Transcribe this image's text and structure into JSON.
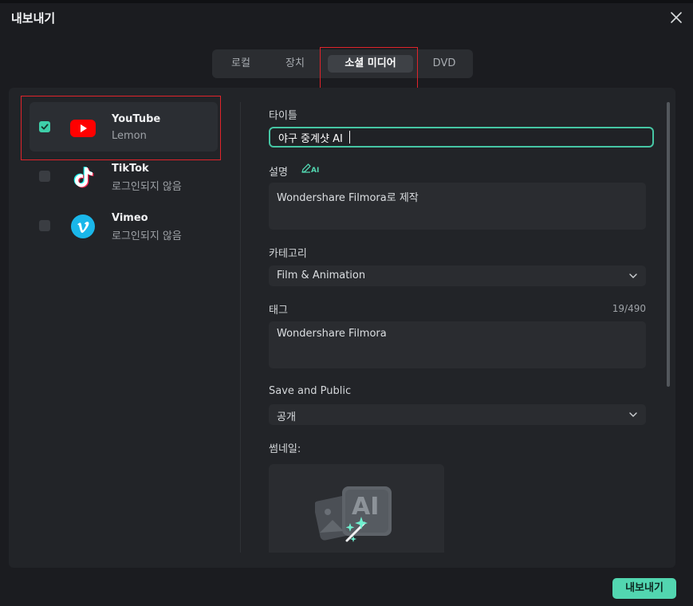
{
  "window": {
    "title": "내보내기"
  },
  "tabs": [
    {
      "label": "로컬",
      "active": false
    },
    {
      "label": "장치",
      "active": false
    },
    {
      "label": "소셜 미디어",
      "active": true
    },
    {
      "label": "DVD",
      "active": false
    }
  ],
  "platforms": [
    {
      "name": "YouTube",
      "status": "Lemon",
      "checked": true,
      "icon": "youtube-logo-icon"
    },
    {
      "name": "TikTok",
      "status": "로그인되지 않음",
      "checked": false,
      "icon": "tiktok-logo-icon"
    },
    {
      "name": "Vimeo",
      "status": "로그인되지 않음",
      "checked": false,
      "icon": "vimeo-logo-icon"
    }
  ],
  "form": {
    "title_label": "타이틀",
    "title_value": "야구 중계샷 AI",
    "description_label": "설명",
    "description_ai_icon": "ai-pen-icon",
    "description_ai_text": "AI",
    "description_value": "Wondershare Filmora로 제작",
    "category_label": "카테고리",
    "category_value": "Film & Animation",
    "tags_label": "태그",
    "tags_count": "19/490",
    "tags_value": "Wondershare Filmora",
    "visibility_label": "Save and Public",
    "visibility_value": "공개",
    "thumbnail_label": "썸네일:",
    "thumbnail_icon": "ai-image-magic-icon",
    "thumbnail_ai_text": "AI"
  },
  "footer": {
    "export_label": "내보내기"
  },
  "colors": {
    "accent": "#52d6b0",
    "highlight_box": "#e0242b",
    "youtube_red": "#ff0000",
    "vimeo_blue": "#1ab7ea"
  }
}
